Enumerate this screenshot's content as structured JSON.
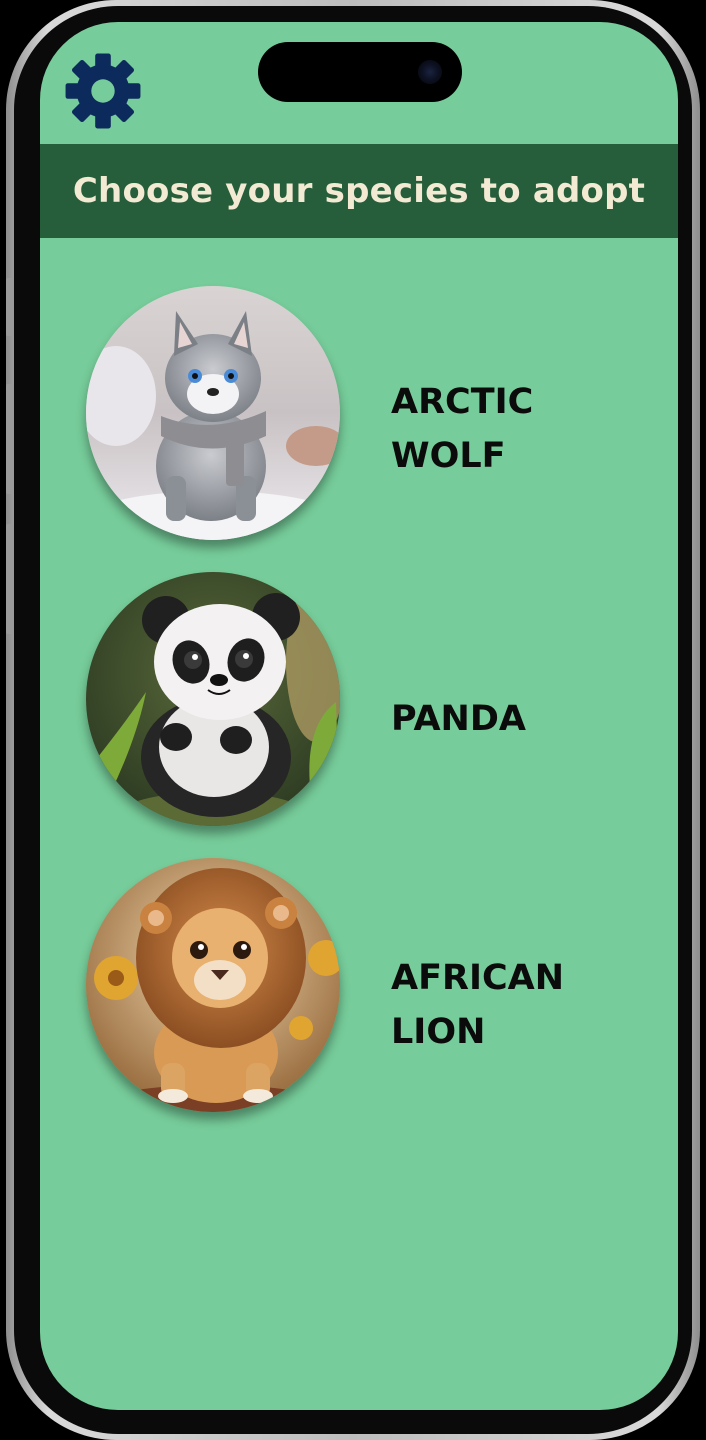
{
  "header": {
    "title": "Choose your species to adopt"
  },
  "toolbar": {
    "settings_icon": "gear-icon"
  },
  "colors": {
    "screen_bg": "#76cc9a",
    "header_bg": "#265e3b",
    "header_text": "#f3ead3",
    "gear": "#0d2a5c"
  },
  "species": [
    {
      "name": "ARCTIC\nWOLF",
      "image": "arctic-wolf-pup"
    },
    {
      "name": "PANDA",
      "image": "panda-cub"
    },
    {
      "name": "AFRICAN\nLION",
      "image": "lion-cub"
    }
  ]
}
